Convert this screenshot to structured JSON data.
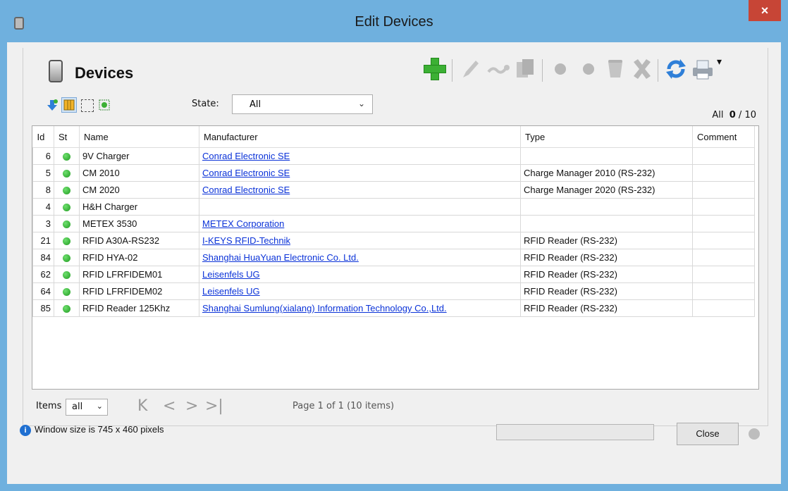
{
  "window": {
    "title": "Edit Devices",
    "close_glyph": "×"
  },
  "panel": {
    "title": "Devices"
  },
  "toolbar": {
    "buttons": [
      "add-icon",
      "edit-icon",
      "link-icon",
      "copy-icon",
      "dot-icon",
      "dot-icon",
      "trash-icon",
      "delete-icon",
      "refresh-icon",
      "print-icon"
    ],
    "dropdown_glyph": "▾"
  },
  "filter": {
    "state_label": "State:",
    "state_value": "All",
    "count_prefix": "All",
    "count_selected": "0",
    "count_sep": "/",
    "count_total": "10"
  },
  "table": {
    "columns": [
      "Id",
      "St",
      "Name",
      "Manufacturer",
      "Type",
      "Comment"
    ],
    "rows": [
      {
        "id": "6",
        "status": "green",
        "name": "9V Charger",
        "manufacturer": "Conrad Electronic SE",
        "type": "",
        "comment": ""
      },
      {
        "id": "5",
        "status": "green",
        "name": "CM 2010",
        "manufacturer": "Conrad Electronic SE",
        "type": "Charge Manager 2010 (RS-232)",
        "comment": ""
      },
      {
        "id": "8",
        "status": "green",
        "name": "CM 2020",
        "manufacturer": "Conrad Electronic SE",
        "type": "Charge Manager 2020 (RS-232)",
        "comment": ""
      },
      {
        "id": "4",
        "status": "green",
        "name": "H&H Charger",
        "manufacturer": "",
        "type": "",
        "comment": ""
      },
      {
        "id": "3",
        "status": "green",
        "name": "METEX 3530",
        "manufacturer": "METEX Corporation",
        "type": "",
        "comment": ""
      },
      {
        "id": "21",
        "status": "green",
        "name": "RFID A30A-RS232",
        "manufacturer": "I-KEYS RFID-Technik",
        "type": "RFID Reader (RS-232)",
        "comment": ""
      },
      {
        "id": "84",
        "status": "green",
        "name": "RFID HYA-02",
        "manufacturer": "Shanghai HuaYuan Electronic Co. Ltd.",
        "type": "RFID Reader (RS-232)",
        "comment": ""
      },
      {
        "id": "62",
        "status": "green",
        "name": "RFID LFRFIDEM01",
        "manufacturer": "Leisenfels UG",
        "type": "RFID Reader (RS-232)",
        "comment": ""
      },
      {
        "id": "64",
        "status": "green",
        "name": "RFID LFRFIDEM02",
        "manufacturer": "Leisenfels UG",
        "type": "RFID Reader (RS-232)",
        "comment": ""
      },
      {
        "id": "85",
        "status": "green",
        "name": "RFID Reader 125Khz",
        "manufacturer": "Shanghai Sumlung(xialang) Information Technology Co.,Ltd.",
        "type": "RFID Reader (RS-232)",
        "comment": ""
      }
    ]
  },
  "pager": {
    "items_label": "Items",
    "items_value": "all",
    "page_info": "Page 1 of 1   (10 items)",
    "first": "K",
    "prev": "<",
    "next": ">",
    "last": ">|"
  },
  "status": {
    "message": "Window size is 745 x 460 pixels",
    "progress_fraction": 0.0
  },
  "footer": {
    "close_label": "Close"
  },
  "colors": {
    "titlebar": "#6fb0de",
    "close": "#c74536",
    "link": "#0a32d8",
    "ok_dot": "#2aa52a",
    "add_green": "#3cb034"
  }
}
